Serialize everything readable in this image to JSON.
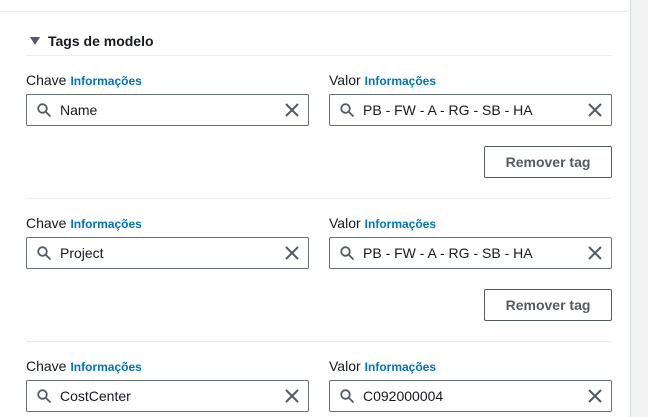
{
  "section": {
    "title": "Tags de modelo"
  },
  "tags": [
    {
      "key_label": "Chave",
      "key_info": "Informações",
      "key_value": "Name",
      "value_label": "Valor",
      "value_info": "Informações",
      "value_value": "PB - FW - A - RG - SB - HA",
      "remove_label": "Remover tag"
    },
    {
      "key_label": "Chave",
      "key_info": "Informações",
      "key_value": "Project",
      "value_label": "Valor",
      "value_info": "Informações",
      "value_value": "PB - FW - A - RG - SB - HA",
      "remove_label": "Remover tag"
    },
    {
      "key_label": "Chave",
      "key_info": "Informações",
      "key_value": "CostCenter",
      "value_label": "Valor",
      "value_info": "Informações",
      "value_value": "C092000004"
    }
  ],
  "icons": {
    "search": "search-icon",
    "clear": "close-icon",
    "expand": "caret-down-icon"
  },
  "colors": {
    "link": "#0073bb",
    "border": "#687078",
    "text": "#16191f"
  }
}
